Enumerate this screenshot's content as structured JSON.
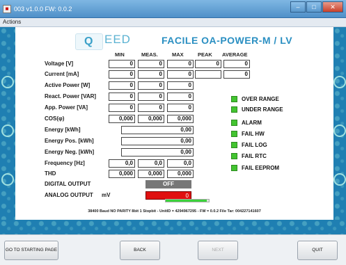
{
  "window": {
    "title": "003 v1.0.0 FW: 0.0.2",
    "icon": "app-icon",
    "minimize": "–",
    "maximize": "□",
    "close": "✕"
  },
  "menu": {
    "actions": "Actions"
  },
  "logo": {
    "q": "Q",
    "eed": "EED"
  },
  "product_title": "FACILE OA-POWER-M / LV",
  "columns": {
    "min": "MIN",
    "meas": "MEAS.",
    "max": "MAX",
    "peak": "PEAK",
    "average": "AVERAGE"
  },
  "rows": [
    {
      "label": "Voltage [V]",
      "min": "0",
      "meas": "0",
      "max": "0",
      "peak": "0",
      "avg": "0"
    },
    {
      "label": "Current [mA]",
      "min": "0",
      "meas": "0",
      "max": "0",
      "peak": "",
      "avg": "0"
    },
    {
      "label": "Active Power [W]",
      "min": "0",
      "meas": "0",
      "max": "0"
    },
    {
      "label": "React. Power [VAR]",
      "min": "0",
      "meas": "0",
      "max": "0"
    },
    {
      "label": "App. Power [VA]",
      "min": "0",
      "meas": "0",
      "max": "0"
    },
    {
      "label": "COS(φ)",
      "min": "0,000",
      "meas": "0,000",
      "max": "0,000"
    },
    {
      "label": "Energy [kWh]",
      "value": "0,00"
    },
    {
      "label": "Energy Pos. [kWh]",
      "value": "0,00"
    },
    {
      "label": "Energy Neg. [kWh]",
      "value": "0,00"
    },
    {
      "label": "Frequency [Hz]",
      "min": "0,0",
      "meas": "0,0",
      "max": "0,0"
    },
    {
      "label": "THD",
      "min": "0,000",
      "meas": "0,000",
      "max": "0,000"
    }
  ],
  "digital_output": {
    "label": "DIGITAL OUTPUT",
    "value": "OFF"
  },
  "analog_output": {
    "label": "ANALOG OUTPUT",
    "unit": "mV",
    "value": "0"
  },
  "status_indicators": [
    "OVER RANGE",
    "UNDER RANGE",
    "ALARM",
    "FAIL HW",
    "FAIL LOG",
    "FAIL RTC",
    "FAIL EEPROM"
  ],
  "colors": {
    "led_ok": "#43c430",
    "analog_bar": "#e01010",
    "accent": "#2a8fc2"
  },
  "progress": {
    "fraction": 0.95
  },
  "status_line": "38400 Baud NO PARITY 8bit 1 Stopbit - UnitID = 4294967295 - FW = 0.0.2 File Tar: 004227141607",
  "buttons": {
    "start": "GO TO STARTING PAGE",
    "back": "BACK",
    "next": "NEXT",
    "quit": "QUIT"
  }
}
